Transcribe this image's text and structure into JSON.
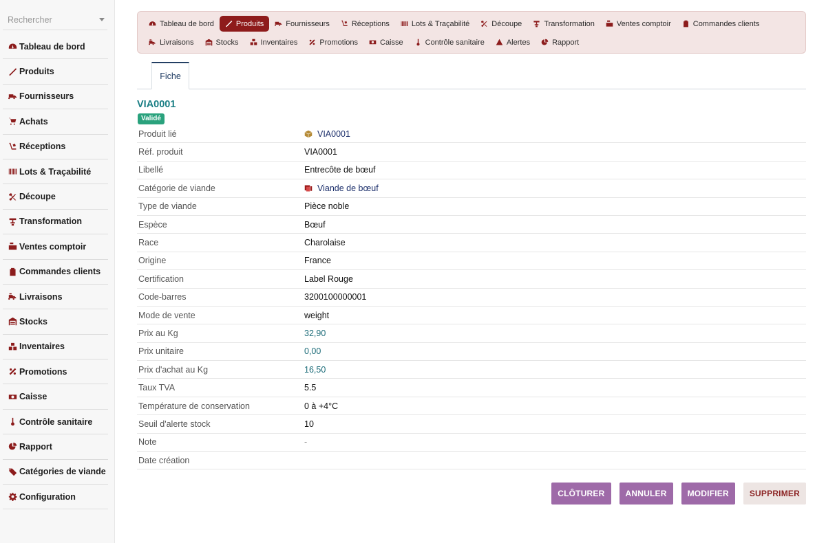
{
  "search": {
    "placeholder": "Rechercher"
  },
  "sidebar": {
    "items": [
      {
        "label": "Tableau de bord",
        "icon": "dashboard-icon"
      },
      {
        "label": "Produits",
        "icon": "knife-icon"
      },
      {
        "label": "Fournisseurs",
        "icon": "truck-icon"
      },
      {
        "label": "Achats",
        "icon": "cart-icon"
      },
      {
        "label": "Réceptions",
        "icon": "dolly-icon"
      },
      {
        "label": "Lots & Traçabilité",
        "icon": "barcode-icon"
      },
      {
        "label": "Découpe",
        "icon": "scissors-icon"
      },
      {
        "label": "Transformation",
        "icon": "meat-grinder-icon"
      },
      {
        "label": "Ventes comptoir",
        "icon": "cash-register-icon"
      },
      {
        "label": "Commandes clients",
        "icon": "clipboard-icon"
      },
      {
        "label": "Livraisons",
        "icon": "delivery-icon"
      },
      {
        "label": "Stocks",
        "icon": "warehouse-icon"
      },
      {
        "label": "Inventaires",
        "icon": "boxes-icon"
      },
      {
        "label": "Promotions",
        "icon": "percent-icon"
      },
      {
        "label": "Caisse",
        "icon": "money-icon"
      },
      {
        "label": "Contrôle sanitaire",
        "icon": "thermometer-icon"
      },
      {
        "label": "Rapport",
        "icon": "pie-chart-icon"
      },
      {
        "label": "Catégories de viande",
        "icon": "tags-icon"
      },
      {
        "label": "Configuration",
        "icon": "gear-icon"
      }
    ]
  },
  "topnav": {
    "row1": [
      {
        "label": "Tableau de bord",
        "icon": "dashboard-icon"
      },
      {
        "label": "Produits",
        "icon": "knife-icon",
        "active": true
      },
      {
        "label": "Fournisseurs",
        "icon": "truck-icon"
      },
      {
        "label": "Réceptions",
        "icon": "dolly-icon"
      },
      {
        "label": "Lots & Traçabilité",
        "icon": "barcode-icon"
      },
      {
        "label": "Découpe",
        "icon": "scissors-icon"
      },
      {
        "label": "Transformation",
        "icon": "meat-grinder-icon"
      },
      {
        "label": "Ventes comptoir",
        "icon": "cash-register-icon"
      },
      {
        "label": "Commandes clients",
        "icon": "clipboard-icon"
      }
    ],
    "row2": [
      {
        "label": "Livraisons",
        "icon": "delivery-icon"
      },
      {
        "label": "Stocks",
        "icon": "warehouse-icon"
      },
      {
        "label": "Inventaires",
        "icon": "boxes-icon"
      },
      {
        "label": "Promotions",
        "icon": "percent-icon"
      },
      {
        "label": "Caisse",
        "icon": "money-icon"
      },
      {
        "label": "Contrôle sanitaire",
        "icon": "thermometer-icon"
      },
      {
        "label": "Alertes",
        "icon": "warning-icon"
      },
      {
        "label": "Rapport",
        "icon": "pie-chart-icon"
      }
    ]
  },
  "tabs": {
    "fiche": "Fiche"
  },
  "record": {
    "ref": "VIA0001",
    "status": "Validé",
    "fields": [
      {
        "label": "Produit lié",
        "value": "VIA0001",
        "kind": "link",
        "icon": "box-icon"
      },
      {
        "label": "Réf. produit",
        "value": "VIA0001"
      },
      {
        "label": "Libellé",
        "value": "Entrecôte de bœuf"
      },
      {
        "label": "Catégorie de viande",
        "value": "Viande de bœuf",
        "kind": "link",
        "icon": "category-icon"
      },
      {
        "label": "Type de viande",
        "value": "Pièce noble"
      },
      {
        "label": "Espèce",
        "value": "Bœuf"
      },
      {
        "label": "Race",
        "value": "Charolaise"
      },
      {
        "label": "Origine",
        "value": "France"
      },
      {
        "label": "Certification",
        "value": "Label Rouge"
      },
      {
        "label": "Code-barres",
        "value": "3200100000001"
      },
      {
        "label": "Mode de vente",
        "value": "weight"
      },
      {
        "label": "Prix au Kg",
        "value": "32,90",
        "kind": "money"
      },
      {
        "label": "Prix unitaire",
        "value": "0,00",
        "kind": "money"
      },
      {
        "label": "Prix d'achat au Kg",
        "value": "16,50",
        "kind": "money"
      },
      {
        "label": "Taux TVA",
        "value": "5.5"
      },
      {
        "label": "Température de conservation",
        "value": "0 à +4°C"
      },
      {
        "label": "Seuil d'alerte stock",
        "value": "10"
      },
      {
        "label": "Note",
        "value": "-",
        "kind": "muted"
      },
      {
        "label": "Date création",
        "value": ""
      }
    ]
  },
  "actions": {
    "close": "CLÔTURER",
    "cancel": "ANNULER",
    "edit": "MODIFIER",
    "delete": "SUPPRIMER"
  },
  "colors": {
    "accent": "#8e1b1b",
    "title": "#1b7f85",
    "badge": "#2aa27d",
    "button": "#9e6aa8"
  }
}
